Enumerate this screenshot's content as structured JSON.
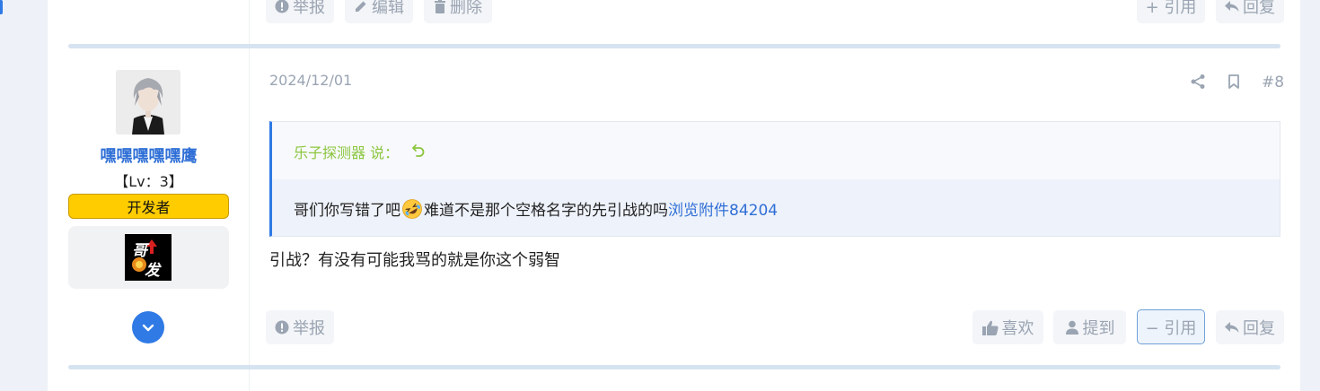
{
  "prev_post": {
    "actions_left": [
      {
        "label": "举报",
        "icon": "report-icon"
      },
      {
        "label": "编辑",
        "icon": "pencil-icon"
      },
      {
        "label": "删除",
        "icon": "trash-icon"
      }
    ],
    "actions_right": [
      {
        "label": "+ 引用",
        "icon": ""
      },
      {
        "label": "回复",
        "icon": "reply-icon"
      }
    ]
  },
  "user": {
    "name": "嘿嘿嘿嘿嘿鹰",
    "level": "【Lv：3】",
    "badge": "开发者",
    "medal_text": "哥发"
  },
  "post": {
    "date": "2024/12/01",
    "number": "#8",
    "quote": {
      "author_line": "乐子探测器 说：",
      "text_before": "哥们你写错了吧",
      "emoji": "rolling-on-floor-laughing-emoji",
      "text_after": "难道不是那个空格名字的先引战的吗",
      "link_text": "浏览附件84204"
    },
    "body": "引战？有没有可能我骂的就是你这个弱智",
    "actions_left": [
      {
        "label": "举报",
        "icon": "report-icon"
      }
    ],
    "actions_right": [
      {
        "label": "喜欢",
        "icon": "thumbs-up-icon"
      },
      {
        "label": "提到",
        "icon": "user-icon"
      },
      {
        "label": "− 引用",
        "icon": ""
      },
      {
        "label": "回复",
        "icon": "reply-icon"
      }
    ]
  },
  "colors": {
    "accent": "#2f7ae5",
    "link": "#2f6fd6",
    "quote_author": "#8cc63e",
    "badge": "#ffcc00",
    "muted": "#9aa4b2"
  }
}
